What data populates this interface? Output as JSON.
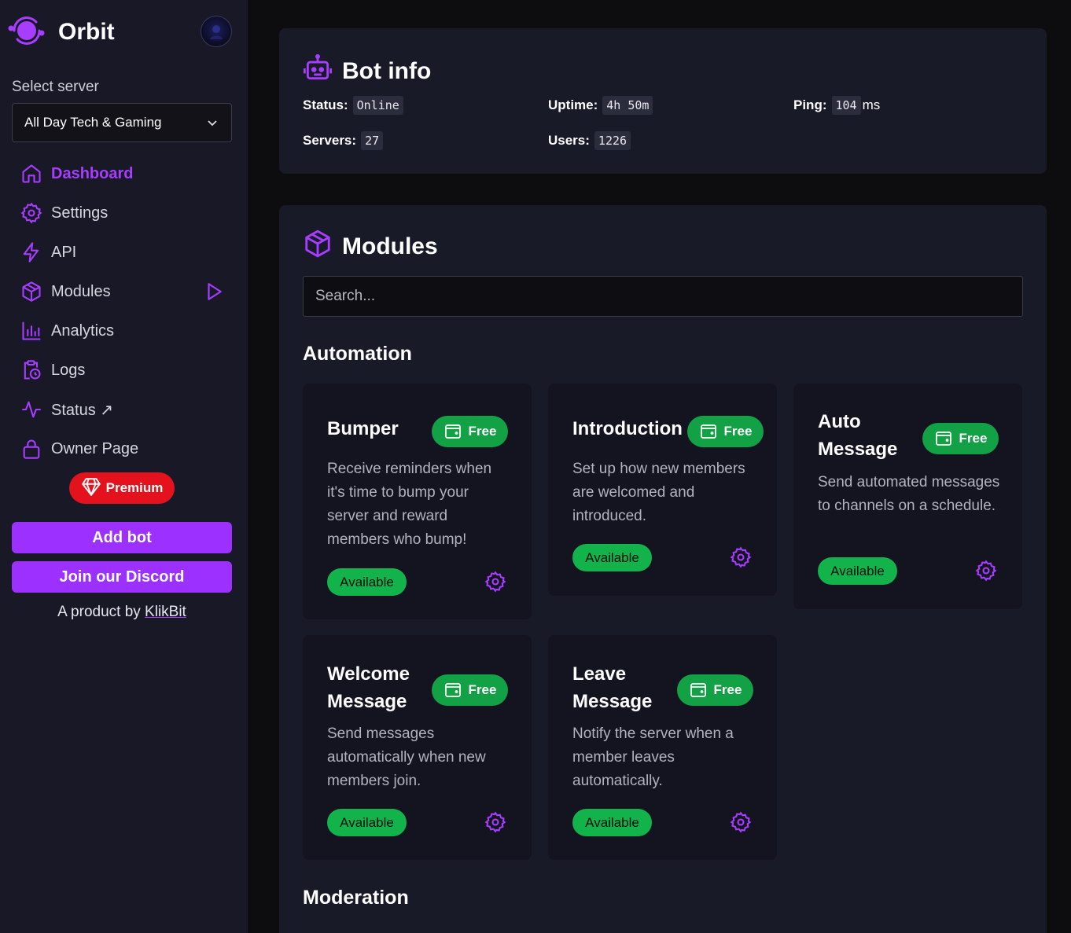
{
  "app": {
    "name": "Orbit"
  },
  "sidebar": {
    "select_label": "Select server",
    "server": "All Day Tech & Gaming",
    "nav": [
      {
        "label": "Dashboard",
        "icon": "home-icon",
        "active": true
      },
      {
        "label": "Settings",
        "icon": "gear-icon"
      },
      {
        "label": "API",
        "icon": "lightning-icon"
      },
      {
        "label": "Modules",
        "icon": "cube-icon"
      },
      {
        "label": "Analytics",
        "icon": "bar-chart-icon"
      },
      {
        "label": "Logs",
        "icon": "clipboard-clock-icon"
      },
      {
        "label": "Status ↗",
        "icon": "pulse-icon"
      },
      {
        "label": "Owner Page",
        "icon": "lock-icon"
      }
    ],
    "premium_label": "Premium",
    "add_bot_label": "Add bot",
    "join_discord_label": "Join our Discord",
    "product_prefix": "A product by ",
    "product_link": "KlikBit"
  },
  "bot_info": {
    "title": "Bot info",
    "status_label": "Status:",
    "status_value": "Online",
    "uptime_label": "Uptime:",
    "uptime_value": "4h 50m",
    "ping_label": "Ping:",
    "ping_value": "104",
    "ping_unit": "ms",
    "servers_label": "Servers:",
    "servers_value": "27",
    "users_label": "Users:",
    "users_value": "1226"
  },
  "modules": {
    "title": "Modules",
    "search_placeholder": "Search...",
    "sections": [
      "Automation",
      "Moderation"
    ],
    "free_label": "Free",
    "available_label": "Available",
    "cards": [
      {
        "title": "Bumper",
        "desc": "Receive reminders when it's time to bump your server and reward members who bump!"
      },
      {
        "title": "Introduction",
        "desc": "Set up how new members are welcomed and introduced."
      },
      {
        "title": "Auto Message",
        "desc": "Send automated messages to channels on a schedule."
      },
      {
        "title": "Welcome Message",
        "desc": "Send messages automatically when new members join."
      },
      {
        "title": "Leave Message",
        "desc": "Notify the server when a member leaves automatically."
      }
    ]
  },
  "colors": {
    "accent": "#a63dff",
    "button": "#9b30ff",
    "success": "#12a144",
    "premium": "#e3121c"
  }
}
